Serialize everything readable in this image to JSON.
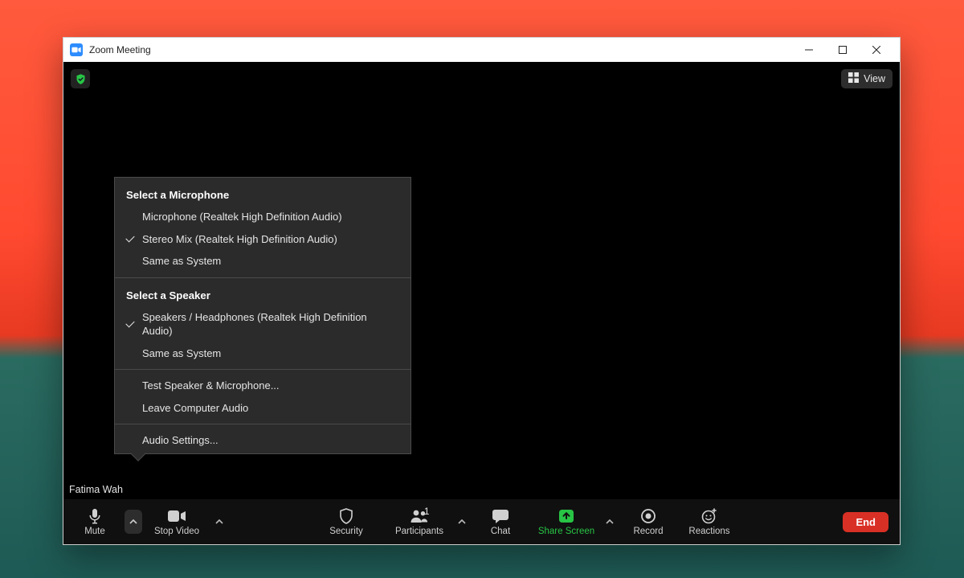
{
  "window_title": "Zoom Meeting",
  "view_label": "View",
  "participant_name_overlay": "Fatima Wah",
  "toolbar": {
    "mute": "Mute",
    "stop_video": "Stop Video",
    "security": "Security",
    "participants": "Participants",
    "participants_count": "1",
    "chat": "Chat",
    "share_screen": "Share Screen",
    "record": "Record",
    "reactions": "Reactions",
    "end": "End"
  },
  "audio_menu": {
    "mic_header": "Select a Microphone",
    "mic_options": [
      {
        "label": "Microphone (Realtek High Definition Audio)",
        "selected": false
      },
      {
        "label": "Stereo Mix (Realtek High Definition Audio)",
        "selected": true
      },
      {
        "label": "Same as System",
        "selected": false
      }
    ],
    "speaker_header": "Select a Speaker",
    "speaker_options": [
      {
        "label": "Speakers / Headphones (Realtek High Definition Audio)",
        "selected": true
      },
      {
        "label": "Same as System",
        "selected": false
      }
    ],
    "test_label": "Test Speaker & Microphone...",
    "leave_label": "Leave Computer Audio",
    "settings_label": "Audio Settings..."
  }
}
